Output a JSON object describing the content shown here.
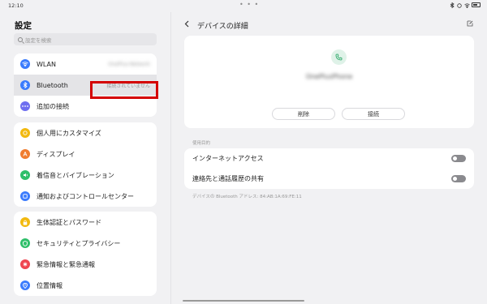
{
  "status_bar": {
    "time": "12:10",
    "dots": "• • •"
  },
  "left": {
    "title": "設定",
    "search_placeholder": "設定を検索",
    "groups": [
      {
        "items": [
          {
            "label": "WLAN",
            "value": "OnePlus-Network",
            "icon": "wifi-icon",
            "color": "#3a7bfd"
          },
          {
            "label": "Bluetooth",
            "value": "接続されていません",
            "icon": "bluetooth-icon",
            "color": "#3a7bfd",
            "selected": true
          },
          {
            "label": "追加の接続",
            "value": "",
            "icon": "more-connections-icon",
            "color": "#6f6ff0"
          }
        ]
      },
      {
        "items": [
          {
            "label": "個人用にカスタマイズ",
            "icon": "personalize-icon",
            "color": "#f2b90f"
          },
          {
            "label": "ディスプレイ",
            "icon": "display-icon",
            "color": "#f07c2e"
          },
          {
            "label": "着信音とバイブレーション",
            "icon": "sound-icon",
            "color": "#2fbf6a"
          },
          {
            "label": "通知およびコントロールセンター",
            "icon": "notification-icon",
            "color": "#3a7bfd"
          }
        ]
      },
      {
        "items": [
          {
            "label": "生体認証とパスワード",
            "icon": "lock-icon",
            "color": "#f2b90f"
          },
          {
            "label": "セキュリティとプライバシー",
            "icon": "shield-icon",
            "color": "#2fbf6a"
          },
          {
            "label": "緊急情報と緊急通報",
            "icon": "emergency-icon",
            "color": "#ef4550"
          },
          {
            "label": "位置情報",
            "icon": "location-icon",
            "color": "#3a7bfd"
          }
        ]
      }
    ]
  },
  "right": {
    "title": "デバイスの詳細",
    "device_name": "OnePlusPhone",
    "delete_label": "削除",
    "connect_label": "接続",
    "section_label": "使用目的",
    "toggles": [
      {
        "label": "インターネットアクセス",
        "on": false
      },
      {
        "label": "連絡先と通話履歴の共有",
        "on": false
      }
    ],
    "address": "デバイスの Bluetooth アドレス: 84:AB:1A:69:FE:11"
  },
  "accent_colors": {
    "highlight": "#d40000",
    "phone_icon": "#19a05b"
  }
}
